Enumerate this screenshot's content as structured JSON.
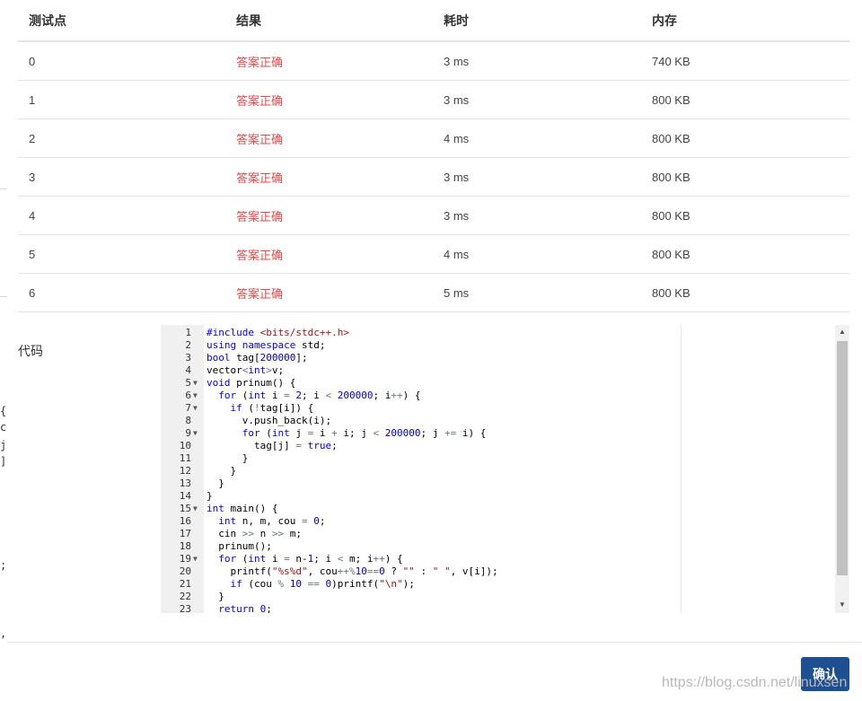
{
  "results": {
    "headers": [
      "测试点",
      "结果",
      "耗时",
      "内存"
    ],
    "rows": [
      {
        "point": "0",
        "result": "答案正确",
        "time": "3 ms",
        "memory": "740 KB"
      },
      {
        "point": "1",
        "result": "答案正确",
        "time": "3 ms",
        "memory": "800 KB"
      },
      {
        "point": "2",
        "result": "答案正确",
        "time": "4 ms",
        "memory": "800 KB"
      },
      {
        "point": "3",
        "result": "答案正确",
        "time": "3 ms",
        "memory": "800 KB"
      },
      {
        "point": "4",
        "result": "答案正确",
        "time": "3 ms",
        "memory": "800 KB"
      },
      {
        "point": "5",
        "result": "答案正确",
        "time": "4 ms",
        "memory": "800 KB"
      },
      {
        "point": "6",
        "result": "答案正确",
        "time": "5 ms",
        "memory": "800 KB"
      }
    ]
  },
  "code_label": "代码",
  "code_lines": [
    {
      "n": "1",
      "fold": false,
      "text": "#include <bits/stdc++.h>"
    },
    {
      "n": "2",
      "fold": false,
      "text": "using namespace std;"
    },
    {
      "n": "3",
      "fold": false,
      "text": "bool tag[200000];"
    },
    {
      "n": "4",
      "fold": false,
      "text": "vector<int>v;"
    },
    {
      "n": "5",
      "fold": true,
      "text": "void prinum() {"
    },
    {
      "n": "6",
      "fold": true,
      "text": "  for (int i = 2; i < 200000; i++) {"
    },
    {
      "n": "7",
      "fold": true,
      "text": "    if (!tag[i]) {"
    },
    {
      "n": "8",
      "fold": false,
      "text": "      v.push_back(i);"
    },
    {
      "n": "9",
      "fold": true,
      "text": "      for (int j = i + i; j < 200000; j += i) {"
    },
    {
      "n": "10",
      "fold": false,
      "text": "        tag[j] = true;"
    },
    {
      "n": "11",
      "fold": false,
      "text": "      }"
    },
    {
      "n": "12",
      "fold": false,
      "text": "    }"
    },
    {
      "n": "13",
      "fold": false,
      "text": "  }"
    },
    {
      "n": "14",
      "fold": false,
      "text": "}"
    },
    {
      "n": "15",
      "fold": true,
      "text": "int main() {"
    },
    {
      "n": "16",
      "fold": false,
      "text": "  int n, m, cou = 0;"
    },
    {
      "n": "17",
      "fold": false,
      "text": "  cin >> n >> m;"
    },
    {
      "n": "18",
      "fold": false,
      "text": "  prinum();"
    },
    {
      "n": "19",
      "fold": true,
      "text": "  for (int i = n-1; i < m; i++) {"
    },
    {
      "n": "20",
      "fold": false,
      "text": "    printf(\"%s%d\", cou++%10==0 ? \"\" : \" \", v[i]);"
    },
    {
      "n": "21",
      "fold": false,
      "text": "    if (cou % 10 == 0)printf(\"\\n\");"
    },
    {
      "n": "22",
      "fold": false,
      "text": "  }"
    },
    {
      "n": "23",
      "fold": false,
      "text": "  return 0;"
    }
  ],
  "confirm_label": "确认",
  "watermark": "https://blog.csdn.net/linuxsen",
  "edge_chars": [
    "{",
    "c",
    "j",
    "]",
    ";",
    ","
  ],
  "colors": {
    "result_ok": "#e84a4a",
    "primary": "#1d4f91"
  }
}
